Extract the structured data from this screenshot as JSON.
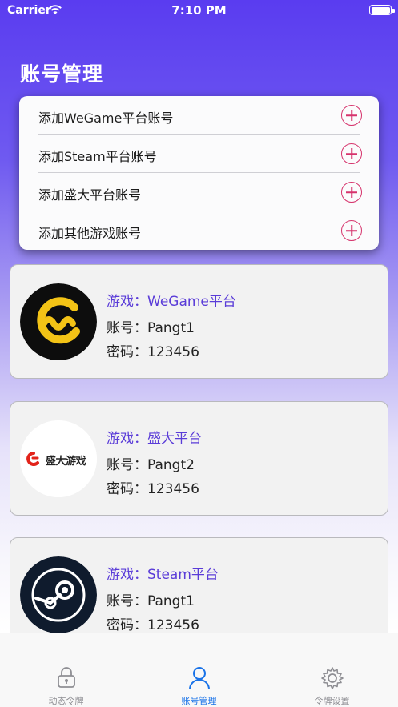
{
  "status_bar": {
    "carrier": "Carrier",
    "time": "7:10 PM"
  },
  "page": {
    "title": "账号管理"
  },
  "add_menu": {
    "items": [
      {
        "label": "添加WeGame平台账号",
        "icon": "plus-circle-icon"
      },
      {
        "label": "添加Steam平台账号",
        "icon": "plus-circle-icon"
      },
      {
        "label": "添加盛大平台账号",
        "icon": "plus-circle-icon"
      },
      {
        "label": "添加其他游戏账号",
        "icon": "plus-circle-icon"
      }
    ]
  },
  "accounts": [
    {
      "game_key": "游戏：",
      "game": "WeGame平台",
      "account_key": "账号：",
      "account": "Pangt1",
      "password_key": "密码：",
      "password": "123456",
      "logo": "wegame-logo"
    },
    {
      "game_key": "游戏：",
      "game": "盛大平台",
      "account_key": "账号：",
      "account": "Pangt2",
      "password_key": "密码：",
      "password": "123456",
      "logo": "shanda-logo",
      "logo_text": "盛大游戏"
    },
    {
      "game_key": "游戏：",
      "game": "Steam平台",
      "account_key": "账号：",
      "account": "Pangt1",
      "password_key": "密码：",
      "password": "123456",
      "logo": "steam-logo"
    }
  ],
  "tabbar": {
    "tabs": [
      {
        "label": "动态令牌",
        "icon": "lock-icon",
        "active": false
      },
      {
        "label": "账号管理",
        "icon": "person-icon",
        "active": true
      },
      {
        "label": "令牌设置",
        "icon": "gear-icon",
        "active": false
      }
    ]
  },
  "colors": {
    "accent": "#5a3cd8",
    "plus": "#d6336c",
    "tab_active": "#1a73e8",
    "header_gradient_top": "#5a3cf0"
  }
}
